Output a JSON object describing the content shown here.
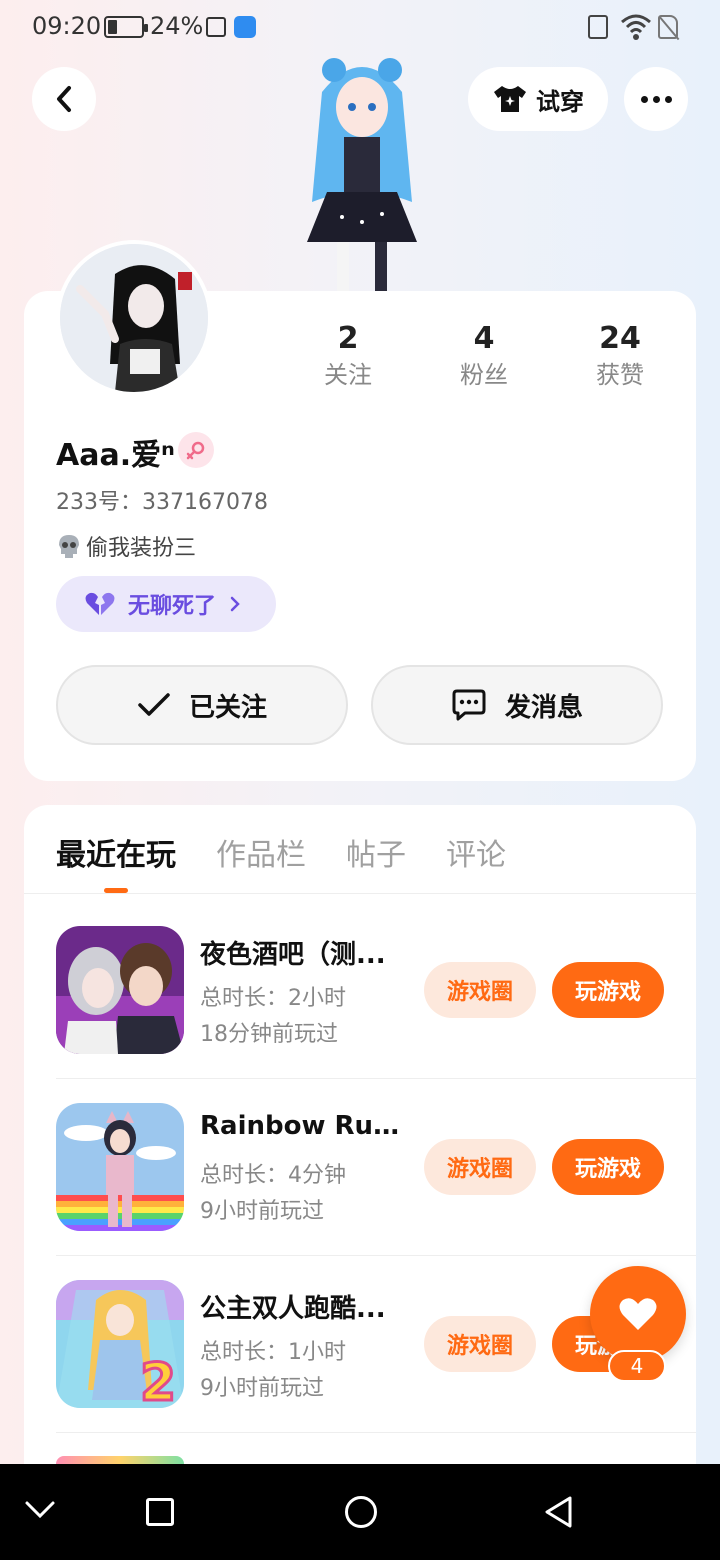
{
  "status_bar": {
    "time": "09:20",
    "battery_percent": "24%",
    "battery_level": 0.24,
    "icons": [
      "battery-icon",
      "notification-icon",
      "app-icon",
      "vibrate-icon",
      "wifi-icon",
      "no-sim-icon"
    ]
  },
  "header": {
    "back_icon": "chevron-left-icon",
    "try_on_label": "试穿",
    "try_on_icon": "tshirt-icon",
    "more_icon": "more-dots-icon"
  },
  "profile": {
    "stats": [
      {
        "value": "2",
        "label": "关注"
      },
      {
        "value": "4",
        "label": "粉丝"
      },
      {
        "value": "24",
        "label": "获赞"
      }
    ],
    "username": "Aaa.爱ⁿ",
    "gender_icon": "female-icon",
    "uid": "233号：337167078",
    "bio_icon": "skull-icon",
    "bio": "偷我装扮三",
    "mood": "无聊死了",
    "follow_label": "已关注",
    "message_label": "发消息"
  },
  "tabs": [
    "最近在玩",
    "作品栏",
    "帖子",
    "评论"
  ],
  "games": [
    {
      "title": "夜色酒吧（测...",
      "duration": "总时长：2小时",
      "last_played": "18分钟前玩过",
      "circle_label": "游戏圈",
      "play_label": "玩游戏"
    },
    {
      "title": "Rainbow Rush...",
      "duration": "总时长：4分钟",
      "last_played": "9小时前玩过",
      "circle_label": "游戏圈",
      "play_label": "玩游戏"
    },
    {
      "title": "公主双人跑酷...",
      "duration": "总时长：1小时",
      "last_played": "9小时前玩过",
      "circle_label": "游戏圈",
      "play_label": "玩游戏"
    }
  ],
  "like_fab": {
    "count": "4"
  },
  "colors": {
    "accent": "#ff6a13",
    "accent_soft": "#fde8dc",
    "mood_bg": "#ebe8fb",
    "mood_text": "#6a4de0"
  },
  "nav": {
    "icons": [
      "back-chevron-icon",
      "home-square-icon",
      "home-circle-icon",
      "back-triangle-icon"
    ]
  }
}
